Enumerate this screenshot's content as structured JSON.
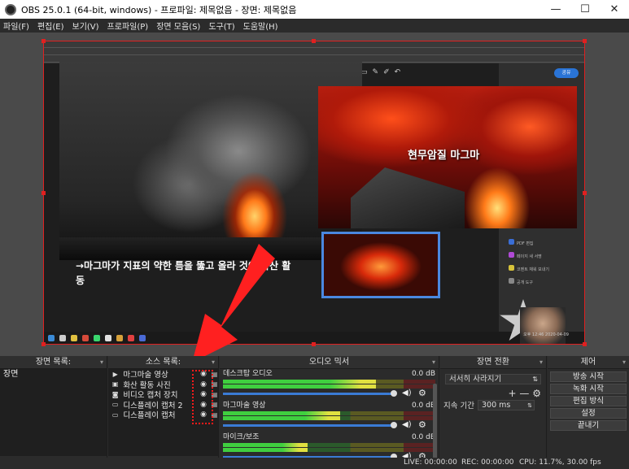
{
  "window": {
    "title": "OBS 25.0.1 (64-bit, windows) - 프로파일: 제목없음 - 장면: 제목없음",
    "minimize": "—",
    "maximize": "☐",
    "close": "✕"
  },
  "menu": [
    "파일(F)",
    "편집(E)",
    "보기(V)",
    "프로파일(P)",
    "장면 모음(S)",
    "도구(T)",
    "도움말(H)"
  ],
  "preview": {
    "caption": "→마그마가 지표의 약한 틈을 뚫고 올라 것이 화산 활동",
    "magma_label": "현무암질 마그마",
    "share_label": "공유",
    "side_items": [
      "PDF 편집",
      "페이지 새 서명",
      "코멘트 채워 보내기",
      "공개 도구"
    ],
    "clock": "오후 12:46\n2020-04-09"
  },
  "scenes": {
    "title": "장면 목록:",
    "items": [
      "장면"
    ],
    "footer": [
      "+",
      "—",
      "∧",
      "∨"
    ]
  },
  "sources": {
    "title": "소스 목록:",
    "items": [
      {
        "icon": "play-icon",
        "glyph": "▶",
        "name": "마그마술 영상"
      },
      {
        "icon": "image-icon",
        "glyph": "▣",
        "name": "화산 활동 사진"
      },
      {
        "icon": "camera-icon",
        "glyph": "◙",
        "name": "비디오 캡처 장치"
      },
      {
        "icon": "monitor-icon",
        "glyph": "▭",
        "name": "디스플레이 캡처 2"
      },
      {
        "icon": "monitor-icon",
        "glyph": "▭",
        "name": "디스플레이 캡처"
      }
    ],
    "footer": [
      "+",
      "—",
      "⚙",
      "∧",
      "∨"
    ]
  },
  "mixer": {
    "title": "오디오 믹서",
    "channels": [
      {
        "name": "데스크탑 오디오",
        "db": "0.0 dB",
        "level": 0.72
      },
      {
        "name": "마그마술 영상",
        "db": "0.0 dB",
        "level": 0.55
      },
      {
        "name": "마이크/보조",
        "db": "0.0 dB",
        "level": 0.4
      }
    ]
  },
  "transitions": {
    "title": "장면 전환",
    "selected": "서서히 사라지기",
    "duration_label": "지속 기간",
    "duration_value": "300 ms"
  },
  "controls": {
    "title": "제어",
    "buttons": [
      "방송 시작",
      "녹화 시작",
      "편집 방식",
      "설정",
      "끝내기"
    ]
  },
  "status": {
    "live": "LIVE: 00:00:00",
    "rec": "REC: 00:00:00",
    "cpu": "CPU: 11.7%, 30.00 fps"
  },
  "colors": {
    "selection": "#e02020",
    "arrow": "#ff2020",
    "fader": "#3a7bd5"
  }
}
